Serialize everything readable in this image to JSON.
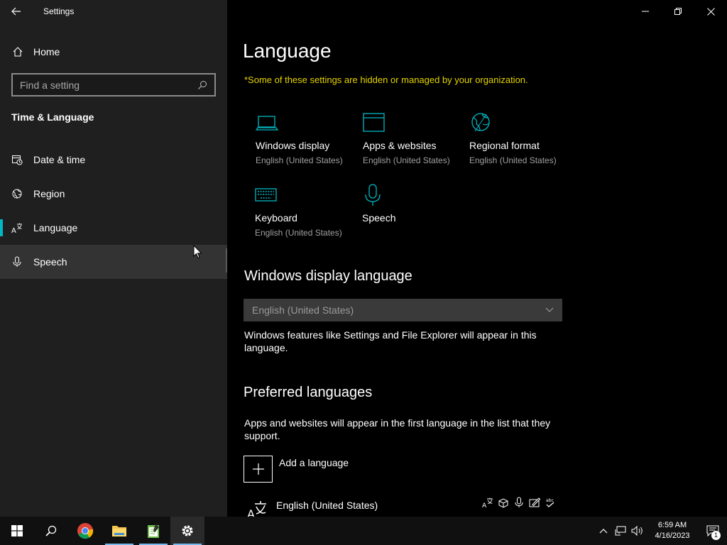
{
  "window": {
    "title": "Settings"
  },
  "sidebar": {
    "home_label": "Home",
    "search_placeholder": "Find a setting",
    "section_title": "Time & Language",
    "items": [
      {
        "label": "Date & time",
        "icon": "date-time-icon"
      },
      {
        "label": "Region",
        "icon": "region-globe-icon"
      },
      {
        "label": "Language",
        "icon": "language-icon",
        "selected": true
      },
      {
        "label": "Speech",
        "icon": "microphone-icon",
        "hovered": true
      }
    ]
  },
  "main": {
    "title": "Language",
    "org_note": "*Some of these settings are hidden or managed by your organization.",
    "tiles": [
      {
        "name": "Windows display",
        "sub": "English (United States)",
        "icon": "laptop-icon"
      },
      {
        "name": "Apps & websites",
        "sub": "English (United States)",
        "icon": "browser-window-icon"
      },
      {
        "name": "Regional format",
        "sub": "English (United States)",
        "icon": "regional-format-globe-icon"
      },
      {
        "name": "Keyboard",
        "sub": "English (United States)",
        "icon": "keyboard-icon"
      },
      {
        "name": "Speech",
        "sub": "",
        "icon": "microphone-icon"
      }
    ],
    "display_language": {
      "heading": "Windows display language",
      "selected": "English (United States)",
      "description": "Windows features like Settings and File Explorer will appear in this language."
    },
    "preferred": {
      "heading": "Preferred languages",
      "description": "Apps and websites will appear in the first language in the list that they support.",
      "add_label": "Add a language",
      "languages": [
        {
          "name": "English (United States)"
        }
      ]
    }
  },
  "taskbar": {
    "time": "6:59 AM",
    "date": "4/16/2023",
    "notification_count": "1",
    "accent": "#76b9ed"
  },
  "colors": {
    "accent": "#00b7c3",
    "warning": "#e6d400",
    "sidebar_bg": "#1f1f1f"
  }
}
